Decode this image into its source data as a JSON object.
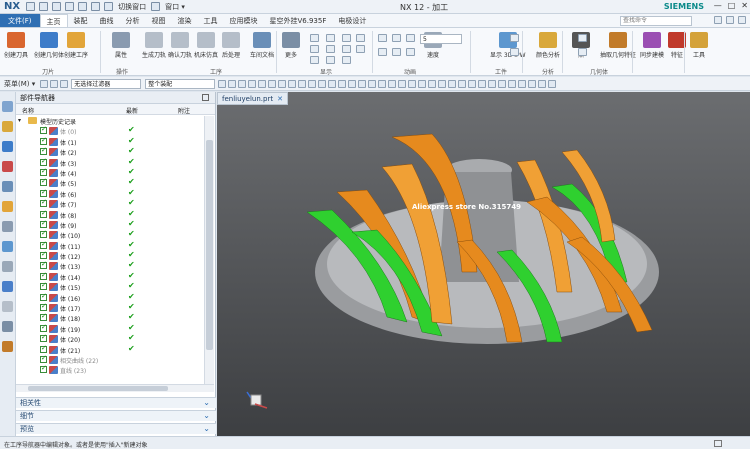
{
  "titlebar": {
    "logo": "NX",
    "switch_window": "切换窗口",
    "window_menu": "窗口 ▾",
    "title": "NX 12 - 加工",
    "brand": "SIEMENS",
    "win_controls": [
      "—",
      "□",
      "✕"
    ]
  },
  "menubar": {
    "file": "文件(F)",
    "tabs": [
      "主页",
      "装配",
      "曲线",
      "分析",
      "视图",
      "渲染",
      "工具",
      "应用模块",
      "星空外挂V6.935F",
      "电极设计"
    ],
    "active_tab": 0,
    "search_placeholder": "查找命令"
  },
  "ribbon": {
    "buttons": [
      {
        "label": "创建刀具",
        "color": "#d9662f"
      },
      {
        "label": "创建几何体",
        "color": "#3d7cc9"
      },
      {
        "label": "创建工序",
        "color": "#e2a53a"
      },
      {
        "label": "属性",
        "color": "#8a9bb0"
      },
      {
        "label": "生成刀轨",
        "color": "#b5bec9"
      },
      {
        "label": "确认刀轨",
        "color": "#b5bec9"
      },
      {
        "label": "机床仿真",
        "color": "#b5bec9"
      },
      {
        "label": "后处理",
        "color": "#b5bec9"
      },
      {
        "label": "车间文档",
        "color": "#6a8fb8"
      },
      {
        "label": "更多",
        "color": "#7a8ea5"
      },
      {
        "label": "速度",
        "color": "#9aa8b8"
      },
      {
        "label": "显示 3D IPW",
        "color": "#5d97cf"
      },
      {
        "label": "颜色分析",
        "color": "#d9a83b"
      },
      {
        "label": "点",
        "color": "#555555"
      },
      {
        "label": "抽取几何特征",
        "color": "#c27b2a"
      },
      {
        "label": "同步建模",
        "color": "#9b4fb3"
      },
      {
        "label": "特征",
        "color": "#c0392b"
      },
      {
        "label": "工具",
        "color": "#d4a23a"
      }
    ],
    "groups": [
      "刀片",
      "操作",
      "工序",
      "显示",
      "动画",
      "工件",
      "分析",
      "几何体"
    ],
    "speed_value": "5"
  },
  "toolbar2": {
    "menu": "菜单(M) ▾",
    "filter": "无选择过滤器",
    "scope": "整个装配"
  },
  "navigator": {
    "title": "部件导航器",
    "columns": {
      "name": "名称",
      "latest": "最新",
      "note": "附注"
    },
    "root": "模型历史记录",
    "items": [
      {
        "label": "体 (0)",
        "dim": true
      },
      {
        "label": "体 (1)",
        "dim": false
      },
      {
        "label": "体 (2)",
        "dim": false
      },
      {
        "label": "体 (3)",
        "dim": false
      },
      {
        "label": "体 (4)",
        "dim": false
      },
      {
        "label": "体 (5)",
        "dim": false
      },
      {
        "label": "体 (6)",
        "dim": false
      },
      {
        "label": "体 (7)",
        "dim": false
      },
      {
        "label": "体 (8)",
        "dim": false
      },
      {
        "label": "体 (9)",
        "dim": false
      },
      {
        "label": "体 (10)",
        "dim": false
      },
      {
        "label": "体 (11)",
        "dim": false
      },
      {
        "label": "体 (12)",
        "dim": false
      },
      {
        "label": "体 (13)",
        "dim": false
      },
      {
        "label": "体 (14)",
        "dim": false
      },
      {
        "label": "体 (15)",
        "dim": false
      },
      {
        "label": "体 (16)",
        "dim": false
      },
      {
        "label": "体 (17)",
        "dim": false
      },
      {
        "label": "体 (18)",
        "dim": false
      },
      {
        "label": "体 (19)",
        "dim": false
      },
      {
        "label": "体 (20)",
        "dim": false
      },
      {
        "label": "体 (21)",
        "dim": false
      },
      {
        "label": "相交曲线 (22)",
        "dim": true
      },
      {
        "label": "直线 (23)",
        "dim": true
      }
    ],
    "check": "✔",
    "sections": [
      "相关性",
      "细节",
      "预览"
    ]
  },
  "viewport": {
    "tab": "fenliuyelun.prt",
    "close": "✕",
    "watermark": "Aliexpress store No.315749"
  },
  "statusbar": {
    "text": "在工序导航器中编辑对象。或者是使用\"插入\"新建对象"
  }
}
